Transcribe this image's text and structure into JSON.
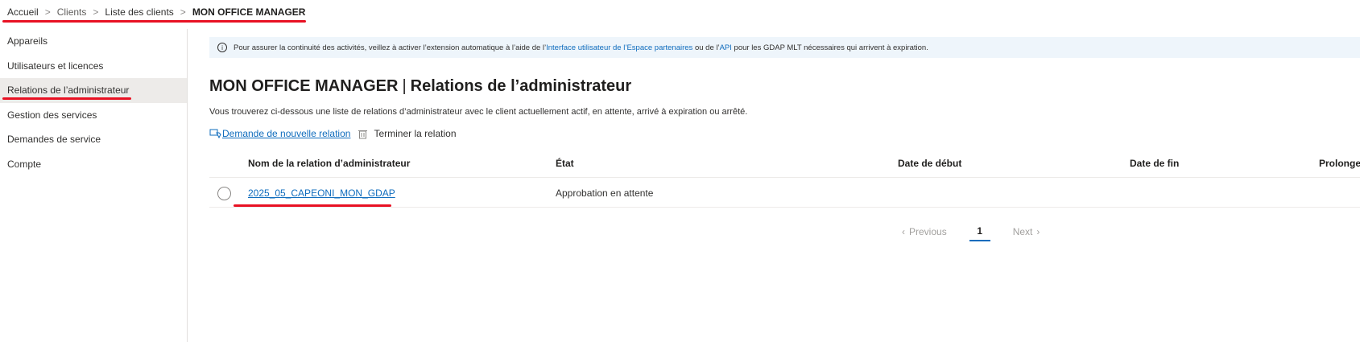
{
  "breadcrumb": {
    "items": [
      "Accueil",
      "Clients",
      "Liste des clients"
    ],
    "current": "MON OFFICE MANAGER"
  },
  "sidebar": {
    "items": [
      {
        "label": "Appareils"
      },
      {
        "label": "Utilisateurs et licences"
      },
      {
        "label": "Relations de l’administrateur"
      },
      {
        "label": "Gestion des services"
      },
      {
        "label": "Demandes de service"
      },
      {
        "label": "Compte"
      }
    ],
    "active_index": 2
  },
  "banner": {
    "text_1": "Pour assurer la continuité des activités, veillez à activer l’extension automatique à l’aide de l’",
    "link_1": "Interface utilisateur de l’Espace partenaires",
    "text_2": " ou de l’",
    "link_2": "API",
    "text_3": " pour les GDAP MLT nécessaires qui arrivent à expiration."
  },
  "page": {
    "title_client": "MON OFFICE MANAGER",
    "title_sep": "|",
    "title_section": "Relations de l’administrateur",
    "description": "Vous trouverez ci-dessous une liste de relations d’administrateur avec le client actuellement actif, en attente, arrivé à expiration ou arrêté."
  },
  "actions": {
    "new_relation": "Demande de nouvelle relation",
    "end_relation": "Terminer la relation"
  },
  "table": {
    "columns": [
      "Nom de la relation d’administrateur",
      "État",
      "Date de début",
      "Date de fin",
      "Prolonge"
    ],
    "rows": [
      {
        "name": "2025_05_CAPEONI_MON_GDAP",
        "state": "Approbation en attente",
        "start": "",
        "end": "",
        "extend": ""
      }
    ]
  },
  "pagination": {
    "previous": "Previous",
    "page": "1",
    "next": "Next"
  },
  "colors": {
    "accent": "#0f6cbd",
    "annotation_red": "#e81123",
    "banner_bg": "#eef5fb",
    "active_nav_bg": "#edebe9"
  }
}
